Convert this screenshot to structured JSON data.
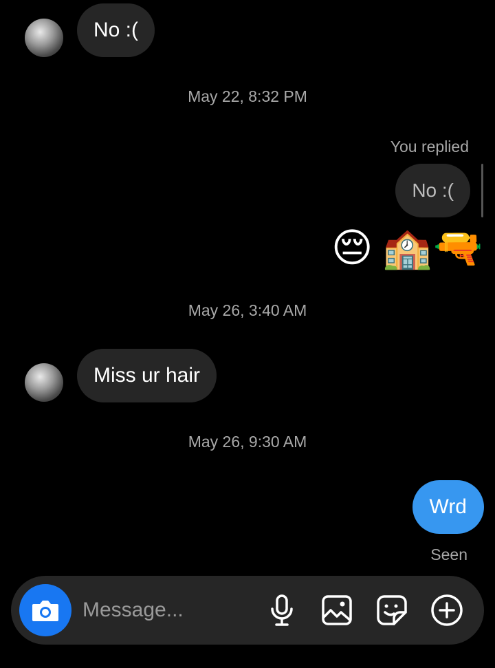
{
  "messages": [
    {
      "type": "incoming",
      "text": "No :("
    },
    {
      "type": "timestamp",
      "text": "May 22, 8:32 PM"
    },
    {
      "type": "reply",
      "label": "You replied",
      "quoted": "No :(",
      "emojis": [
        "😔",
        "🏫",
        "🔫"
      ]
    },
    {
      "type": "timestamp",
      "text": "May 26, 3:40 AM"
    },
    {
      "type": "incoming",
      "text": "Miss ur hair"
    },
    {
      "type": "timestamp",
      "text": "May 26, 9:30 AM"
    },
    {
      "type": "outgoing",
      "text": "Wrd",
      "status": "Seen"
    }
  ],
  "composer": {
    "placeholder": "Message...",
    "icons": [
      "camera-icon",
      "microphone-icon",
      "gallery-icon",
      "sticker-icon",
      "plus-icon"
    ]
  },
  "colors": {
    "background": "#000000",
    "incoming_bubble": "#262626",
    "outgoing_bubble": "#3797f0",
    "camera_button": "#1877f2"
  }
}
